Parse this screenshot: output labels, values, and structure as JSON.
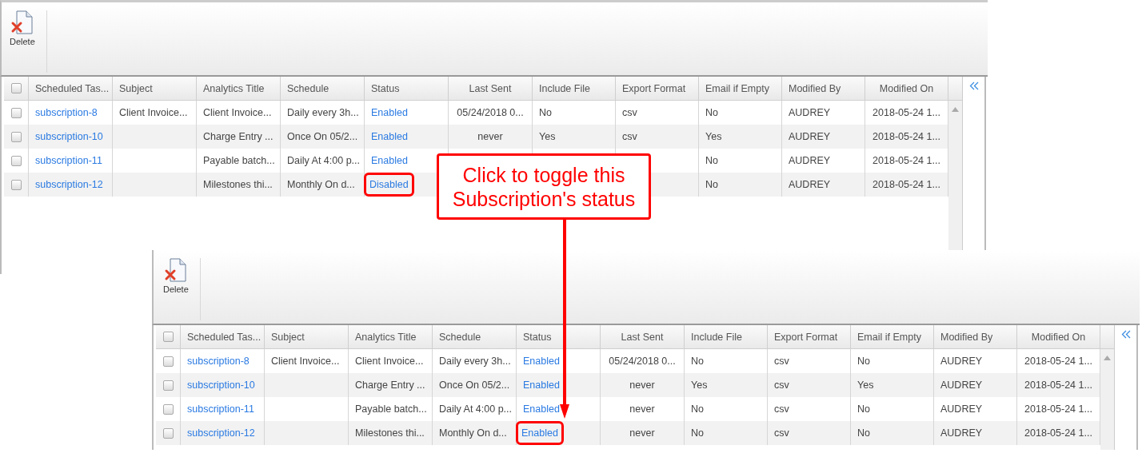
{
  "panels": [
    {
      "toolbar": {
        "buttons": [
          {
            "label": "Delete"
          }
        ]
      },
      "header_checkbox": {
        "checked": false
      },
      "columns": [
        {
          "label": "Scheduled Tas...",
          "kind": "link"
        },
        {
          "label": "Subject",
          "kind": "text"
        },
        {
          "label": "Analytics Title",
          "kind": "text"
        },
        {
          "label": "Schedule",
          "kind": "text"
        },
        {
          "label": "Status",
          "kind": "status"
        },
        {
          "label": "Last Sent",
          "kind": "centered"
        },
        {
          "label": "Include File",
          "kind": "text"
        },
        {
          "label": "Export Format",
          "kind": "text"
        },
        {
          "label": "Email if Empty",
          "kind": "text"
        },
        {
          "label": "Modified By",
          "kind": "text"
        },
        {
          "label": "Modified On",
          "kind": "centered"
        }
      ],
      "rows": [
        {
          "checked": false,
          "highlighted": false,
          "cells": [
            "subscription-8",
            "Client Invoice...",
            "Client Invoice...",
            "Daily every 3h...",
            "Enabled",
            "05/24/2018 0...",
            "No",
            "csv",
            "No",
            "AUDREY",
            "2018-05-24 1..."
          ]
        },
        {
          "checked": false,
          "highlighted": false,
          "cells": [
            "subscription-10",
            null,
            "Charge Entry ...",
            "Once On 05/2...",
            "Enabled",
            "never",
            "Yes",
            "csv",
            "Yes",
            "AUDREY",
            "2018-05-24 1..."
          ]
        },
        {
          "checked": false,
          "highlighted": false,
          "cells": [
            "subscription-11",
            null,
            "Payable batch...",
            "Daily At 4:00 p...",
            "Enabled",
            null,
            null,
            null,
            "No",
            "AUDREY",
            "2018-05-24 1..."
          ]
        },
        {
          "checked": false,
          "highlighted": true,
          "cells": [
            "subscription-12",
            null,
            "Milestones thi...",
            "Monthly On d...",
            "Disabled",
            null,
            null,
            null,
            "No",
            "AUDREY",
            "2018-05-24 1..."
          ]
        }
      ]
    },
    {
      "toolbar": {
        "buttons": [
          {
            "label": "Delete"
          }
        ]
      },
      "header_checkbox": {
        "checked": false
      },
      "columns": [
        {
          "label": "Scheduled Tas...",
          "kind": "link"
        },
        {
          "label": "Subject",
          "kind": "text"
        },
        {
          "label": "Analytics Title",
          "kind": "text"
        },
        {
          "label": "Schedule",
          "kind": "text"
        },
        {
          "label": "Status",
          "kind": "status"
        },
        {
          "label": "Last Sent",
          "kind": "centered"
        },
        {
          "label": "Include File",
          "kind": "text"
        },
        {
          "label": "Export Format",
          "kind": "text"
        },
        {
          "label": "Email if Empty",
          "kind": "text"
        },
        {
          "label": "Modified By",
          "kind": "text"
        },
        {
          "label": "Modified On",
          "kind": "centered"
        }
      ],
      "rows": [
        {
          "checked": false,
          "highlighted": false,
          "cells": [
            "subscription-8",
            "Client Invoice...",
            "Client Invoice...",
            "Daily every 3h...",
            "Enabled",
            "05/24/2018 0...",
            "No",
            "csv",
            "No",
            "AUDREY",
            "2018-05-24 1..."
          ]
        },
        {
          "checked": false,
          "highlighted": false,
          "cells": [
            "subscription-10",
            null,
            "Charge Entry ...",
            "Once On 05/2...",
            "Enabled",
            "never",
            "Yes",
            "csv",
            "Yes",
            "AUDREY",
            "2018-05-24 1..."
          ]
        },
        {
          "checked": false,
          "highlighted": false,
          "cells": [
            "subscription-11",
            null,
            "Payable batch...",
            "Daily At 4:00 p...",
            "Enabled",
            "never",
            "No",
            "csv",
            "No",
            "AUDREY",
            "2018-05-24 1..."
          ]
        },
        {
          "checked": false,
          "highlighted": true,
          "cells": [
            "subscription-12",
            null,
            "Milestones thi...",
            "Monthly On d...",
            "Enabled",
            "never",
            "No",
            "csv",
            "No",
            "AUDREY",
            "2018-05-24 1..."
          ]
        }
      ]
    }
  ],
  "callout": {
    "text": "Click to toggle this Subscription's status"
  }
}
